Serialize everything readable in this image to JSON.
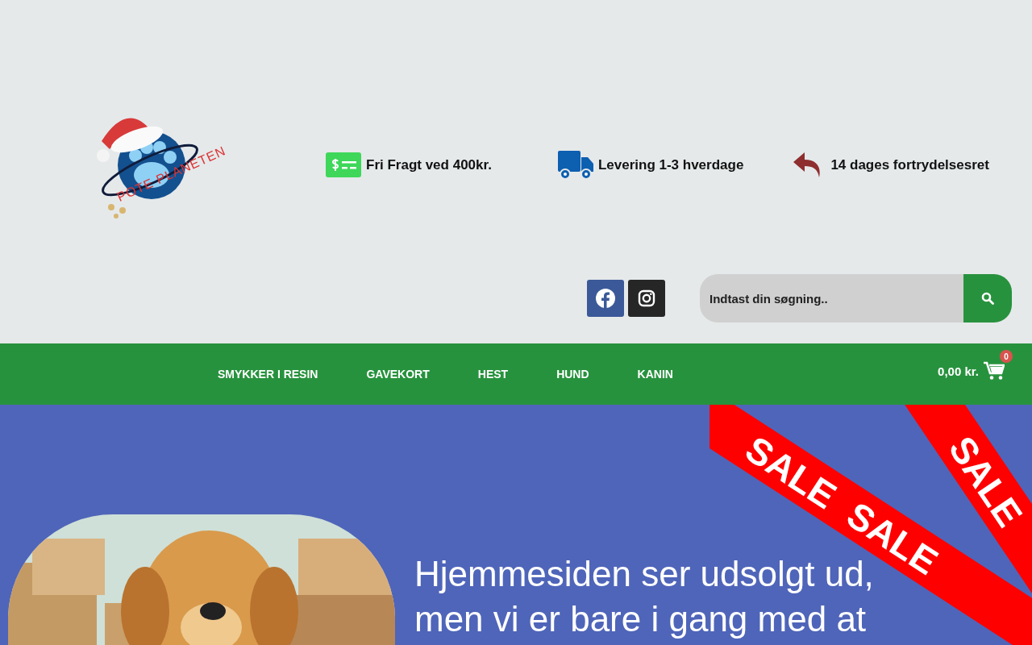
{
  "logo": {
    "text": "POTE PLANETEN"
  },
  "features": [
    {
      "kind": "money",
      "text": "Fri Fragt ved 400kr."
    },
    {
      "kind": "truck",
      "text": "Levering 1-3 hverdage"
    },
    {
      "kind": "return",
      "text": "14 dages fortrydelsesret"
    }
  ],
  "social": [
    {
      "kind": "facebook"
    },
    {
      "kind": "instagram"
    }
  ],
  "search": {
    "placeholder": "Indtast din søgning.."
  },
  "nav": {
    "items": [
      "SMYKKER I RESIN",
      "GAVEKORT",
      "HEST",
      "HUND",
      "KANIN"
    ],
    "cart_total": "0,00 kr.",
    "cart_count": "0"
  },
  "banner": {
    "heading": [
      "Hjemmesiden ser udsolgt ud,",
      "men vi er bare i gang med at"
    ],
    "ribbons": [
      [
        "SALE",
        "SALE"
      ],
      [
        "SALE"
      ]
    ]
  }
}
